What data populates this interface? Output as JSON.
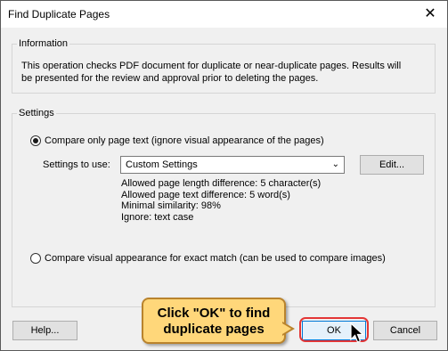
{
  "window": {
    "title": "Find Duplicate Pages",
    "close_glyph": "✕"
  },
  "information": {
    "group_label": "Information",
    "text": "This operation checks PDF document for duplicate or near-duplicate pages. Results will be presented for the review and approval prior to deleting the pages."
  },
  "settings": {
    "group_label": "Settings",
    "option_text": {
      "label": "Compare only page text (ignore visual appearance of the pages)",
      "selected": true
    },
    "settings_to_use_label": "Settings to use:",
    "select": {
      "value": "Custom Settings",
      "arrow": "⌄"
    },
    "edit_button": "Edit...",
    "details": [
      "Allowed page length difference: 5 character(s)",
      "Allowed page text difference: 5 word(s)",
      "Minimal similarity: 98%",
      "Ignore: text case"
    ],
    "option_visual": {
      "label": "Compare visual appearance for exact match (can be used to compare images)",
      "selected": false
    }
  },
  "buttons": {
    "help": "Help...",
    "ok": "OK",
    "cancel": "Cancel"
  },
  "callout": {
    "line1": "Click \"OK\" to find",
    "line2": "duplicate pages"
  }
}
